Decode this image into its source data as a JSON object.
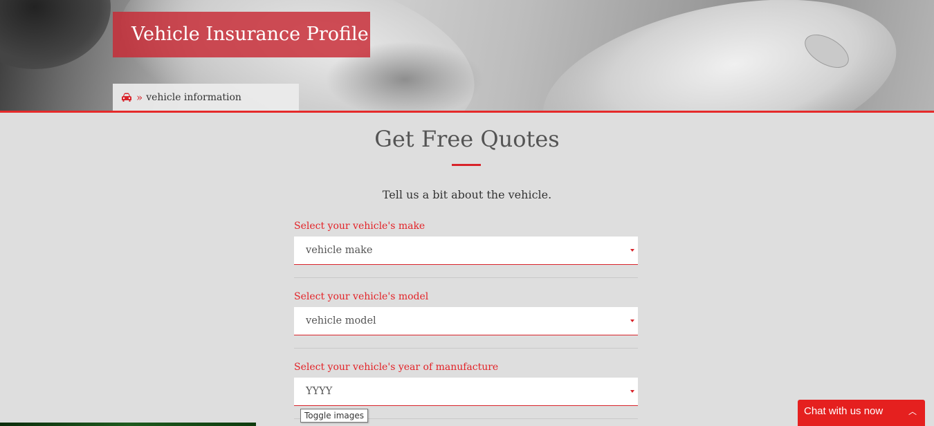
{
  "header": {
    "title": "Vehicle Insurance Profile",
    "breadcrumb": {
      "icon": "car-icon",
      "separator": "»",
      "label": "vehicle information"
    }
  },
  "main": {
    "heading": "Get Free Quotes",
    "subtitle": "Tell us a bit about the vehicle.",
    "fields": [
      {
        "label": "Select your vehicle's make",
        "value": "vehicle make"
      },
      {
        "label": "Select your vehicle's model",
        "value": "vehicle model"
      },
      {
        "label": "Select your vehicle's year of manufacture",
        "value": "YYYY"
      }
    ]
  },
  "tooltip": "Toggle images",
  "chat": {
    "label": "Chat with us now",
    "icon": "chevron-up-icon"
  },
  "colors": {
    "accent": "#d8232a",
    "background": "#dedede"
  }
}
